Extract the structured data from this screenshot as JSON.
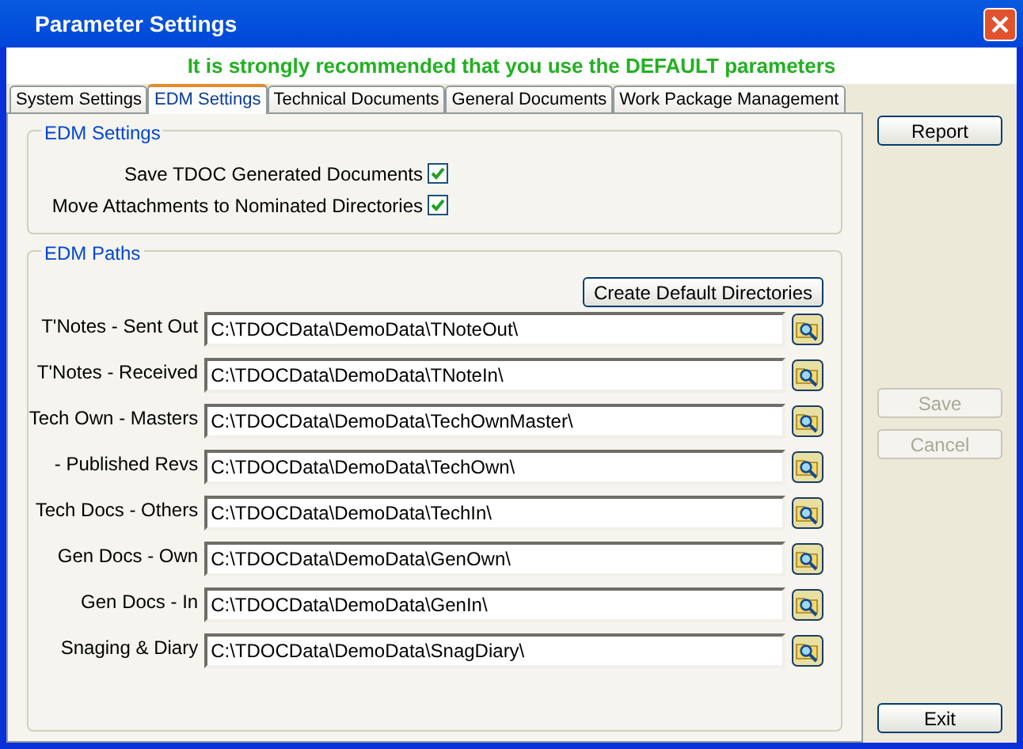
{
  "window": {
    "title": "Parameter Settings"
  },
  "banner": "It is strongly recommended that you use the DEFAULT parameters",
  "tabs": [
    {
      "label": "System Settings",
      "selected": false
    },
    {
      "label": "EDM Settings",
      "selected": true
    },
    {
      "label": "Technical Documents",
      "selected": false
    },
    {
      "label": "General Documents",
      "selected": false
    },
    {
      "label": "Work Package Management",
      "selected": false
    }
  ],
  "edm_settings": {
    "title": "EDM Settings",
    "options": [
      {
        "label": "Save TDOC Generated Documents",
        "checked": true
      },
      {
        "label": "Move Attachments to Nominated Directories",
        "checked": true
      }
    ]
  },
  "edm_paths": {
    "title": "EDM Paths",
    "create_button": "Create Default Directories",
    "paths": [
      {
        "label": "T'Notes - Sent Out",
        "value": "C:\\TDOCData\\DemoData\\TNoteOut\\"
      },
      {
        "label": "T'Notes - Received",
        "value": "C:\\TDOCData\\DemoData\\TNoteIn\\"
      },
      {
        "label": "Tech Own - Masters",
        "value": "C:\\TDOCData\\DemoData\\TechOwnMaster\\"
      },
      {
        "label": "- Published Revs",
        "value": "C:\\TDOCData\\DemoData\\TechOwn\\"
      },
      {
        "label": "Tech Docs - Others",
        "value": "C:\\TDOCData\\DemoData\\TechIn\\"
      },
      {
        "label": "Gen Docs - Own",
        "value": "C:\\TDOCData\\DemoData\\GenOwn\\"
      },
      {
        "label": "Gen Docs - In",
        "value": "C:\\TDOCData\\DemoData\\GenIn\\"
      },
      {
        "label": "Snaging & Diary",
        "value": "C:\\TDOCData\\DemoData\\SnagDiary\\"
      }
    ]
  },
  "side_buttons": [
    {
      "label": "Report",
      "disabled": false
    },
    {
      "label": "Save",
      "disabled": true
    },
    {
      "label": "Cancel",
      "disabled": true
    },
    {
      "label": "Exit",
      "disabled": false
    }
  ]
}
